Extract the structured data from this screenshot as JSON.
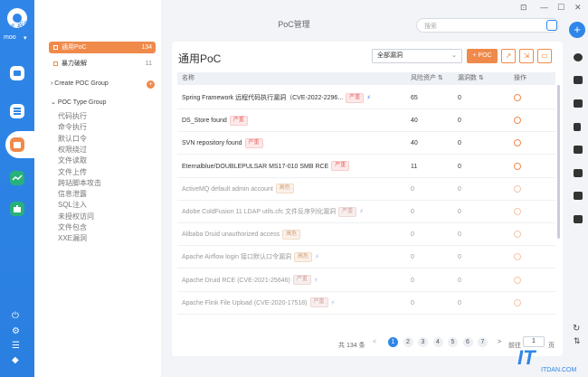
{
  "app": {
    "user": "moo",
    "header_title": "PoC管理",
    "back_label": "返回",
    "search_placeholder": "搜索"
  },
  "window_controls": [
    "⊡",
    "—",
    "☐",
    "✕"
  ],
  "sidebar": {
    "items": [
      {
        "label": "通用PoC",
        "count": "134",
        "active": true
      },
      {
        "label": "暴力破解",
        "count": "11",
        "active": false
      }
    ],
    "create_group": "Create POC Group",
    "type_group": "POC Type Group",
    "types": [
      "代码执行",
      "命令执行",
      "默认口令",
      "权限绕过",
      "文件读取",
      "文件上传",
      "跨站脚本攻击",
      "信息泄露",
      "SQL注入",
      "未授权访问",
      "文件包含",
      "XXE漏洞"
    ]
  },
  "main": {
    "title": "通用PoC",
    "filter_value": "全部漏洞",
    "add_poc_label": "+ POC",
    "columns": {
      "name": "名称",
      "risk_assets": "风险资产",
      "vuln_count": "漏洞数",
      "ops": "操作"
    },
    "rows": [
      {
        "name": "Spring Framework 远程代码执行漏洞（CVE-2022-2296...",
        "tag": "严重",
        "tag_type": "severe",
        "bolt": true,
        "risk": "65",
        "vuln": "0",
        "dim": false
      },
      {
        "name": "DS_Store found",
        "tag": "严重",
        "tag_type": "severe",
        "bolt": false,
        "risk": "40",
        "vuln": "0",
        "dim": false
      },
      {
        "name": "SVN repository found",
        "tag": "严重",
        "tag_type": "severe",
        "bolt": false,
        "risk": "40",
        "vuln": "0",
        "dim": false
      },
      {
        "name": "Eternalblue/DOUBLEPULSAR MS17-010 SMB RCE",
        "tag": "严重",
        "tag_type": "severe",
        "bolt": false,
        "risk": "11",
        "vuln": "0",
        "dim": false
      },
      {
        "name": "ActiveMQ default admin account",
        "tag": "高危",
        "tag_type": "high",
        "bolt": false,
        "risk": "0",
        "vuln": "0",
        "dim": true
      },
      {
        "name": "Adobe ColdFusion 11 LDAP utils.cfc 文件反序列化漏洞",
        "tag": "严重",
        "tag_type": "dim-severe",
        "bolt": true,
        "risk": "0",
        "vuln": "0",
        "dim": true
      },
      {
        "name": "Alibaba Druid unauthorized access",
        "tag": "高危",
        "tag_type": "high",
        "bolt": false,
        "risk": "0",
        "vuln": "0",
        "dim": true
      },
      {
        "name": "Apache Airflow login 接口默认口令漏洞",
        "tag": "高危",
        "tag_type": "high",
        "bolt": true,
        "risk": "0",
        "vuln": "0",
        "dim": true
      },
      {
        "name": "Apache Druid RCE (CVE-2021-25646)",
        "tag": "严重",
        "tag_type": "dim-severe",
        "bolt": true,
        "risk": "0",
        "vuln": "0",
        "dim": true
      },
      {
        "name": "Apache Flink File Upload (CVE-2020-17518)",
        "tag": "严重",
        "tag_type": "dim-severe",
        "bolt": true,
        "risk": "0",
        "vuln": "0",
        "dim": true
      }
    ]
  },
  "pager": {
    "total": "共 134 条",
    "pages": [
      "1",
      "2",
      "3",
      "4",
      "5",
      "6",
      "7"
    ],
    "next": ">",
    "prev": "<",
    "goto_label": "前往",
    "goto_value": "1",
    "page_suffix": "页"
  },
  "watermark": {
    "logo": "IT",
    "url": "ITDAN.COM"
  },
  "colors": {
    "accent": "#2f86e8",
    "orange": "#f08a4b",
    "severe": "#e86a6a"
  }
}
